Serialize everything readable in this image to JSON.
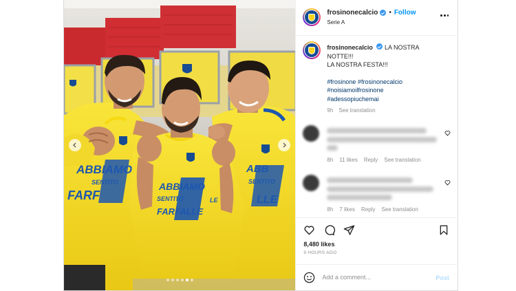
{
  "header": {
    "username": "frosinonecalcio",
    "separator": "•",
    "follow_label": "Follow",
    "subtitle": "Serie A",
    "more_icon": "more-horizontal-icon"
  },
  "caption": {
    "username": "frosinonecalcio",
    "text": "LA NOSTRA NOTTE!!!\nLA NOSTRA FESTA!!!",
    "hashtags": [
      "#frosinone #frosinonecalcio",
      "#noisiamoilfrosinone",
      "#adessopiuchemai"
    ],
    "time": "9h",
    "see_translation": "See translation"
  },
  "photo": {
    "shirt_text": [
      "ABBIAMO",
      "SENTITO",
      "LE",
      "FARFALLE"
    ]
  },
  "comments": [
    {
      "blurred": true,
      "time": "8h",
      "likes": "11 likes",
      "reply": "Reply",
      "see_translation": "See translation"
    },
    {
      "blurred": true,
      "time": "8h",
      "likes": "7 likes",
      "reply": "Reply",
      "see_translation": "See translation"
    }
  ],
  "actions": {
    "icons": [
      "heart-icon",
      "comment-icon",
      "share-icon",
      "bookmark-icon"
    ],
    "likes": "8,480 likes",
    "timestamp": "9 HOURS AGO"
  },
  "add_comment": {
    "placeholder": "Add a comment...",
    "post_label": "Post"
  },
  "carousel": {
    "slide_count": 6,
    "active_index": 4
  },
  "colors": {
    "follow": "#0095f6",
    "hashtag": "#00376b",
    "shirt_yellow": "#f6dd1f",
    "club_blue": "#174c93"
  }
}
